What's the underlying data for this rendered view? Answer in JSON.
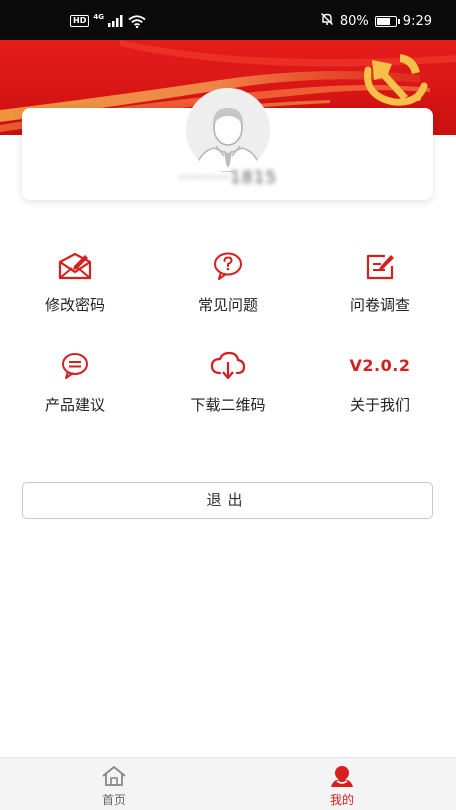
{
  "status_bar": {
    "hd": "HD",
    "network": "4G",
    "battery": "80%",
    "battery_level": 0.8,
    "time": "9:29"
  },
  "profile": {
    "username": "········1815"
  },
  "menu": [
    {
      "label": "修改密码",
      "icon": "envelope-edit-icon"
    },
    {
      "label": "常见问题",
      "icon": "question-bubble-icon"
    },
    {
      "label": "问卷调查",
      "icon": "survey-edit-icon"
    },
    {
      "label": "产品建议",
      "icon": "chat-bubble-icon"
    },
    {
      "label": "下载二维码",
      "icon": "cloud-download-icon"
    },
    {
      "label": "关于我们",
      "version": "V2.0.2"
    }
  ],
  "logout_label": "退出",
  "nav": [
    {
      "label": "首页",
      "icon": "home-icon",
      "active": false
    },
    {
      "label": "我的",
      "icon": "user-icon",
      "active": true
    }
  ],
  "colors": {
    "accent": "#d52020",
    "banner": "#d81515",
    "gold": "#f6c14a"
  }
}
